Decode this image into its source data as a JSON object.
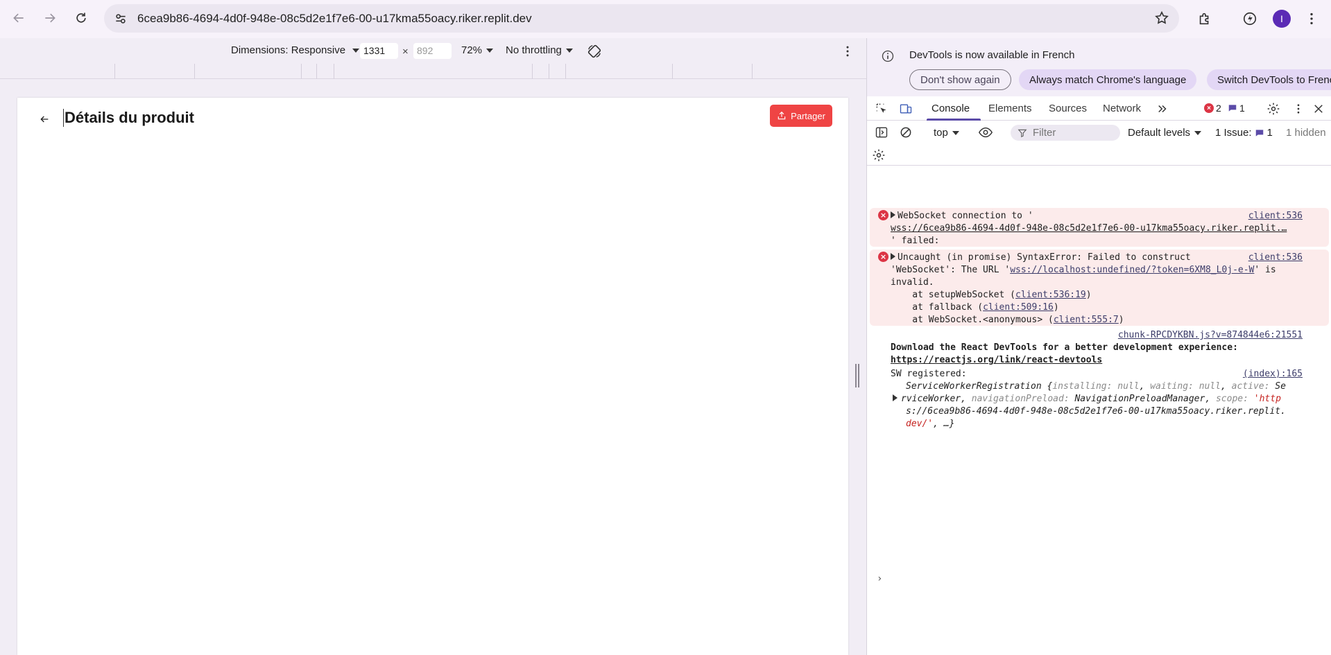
{
  "browser": {
    "url": "6cea9b86-4694-4d0f-948e-08c5d2e1f7e6-00-u17kma55oacy.riker.replit.dev",
    "avatar_letter": "I"
  },
  "device_toolbar": {
    "dimensions_label": "Dimensions: Responsive",
    "width_value": "1331",
    "height_value": "892",
    "times": "×",
    "zoom": "72%",
    "throttling": "No throttling"
  },
  "page": {
    "title": "Détails du produit",
    "share_label": "Partager"
  },
  "devtools": {
    "info": {
      "message": "DevTools is now available in French",
      "dont_show": "Don't show again",
      "always_match": "Always match Chrome's language",
      "switch": "Switch DevTools to French"
    },
    "tabs": [
      "Console",
      "Elements",
      "Sources",
      "Network"
    ],
    "error_count": "2",
    "message_count": "1",
    "console_bar": {
      "context": "top",
      "filter_placeholder": "Filter",
      "levels": "Default levels",
      "issues_label": "1 Issue:",
      "issues_count": "1",
      "hidden": "1 hidden"
    },
    "console": {
      "msg1": {
        "l1": "WebSocket connection to '",
        "l2": "wss://6cea9b86-4694-4d0f-948e-08c5d2e1f7e6-00-u17kma55oacy.riker.replit.…",
        "l3": "' failed:",
        "src": "client:536"
      },
      "msg2": {
        "l1": "Uncaught (in promise) SyntaxError: Failed to construct",
        "l2_pre": "'WebSocket': The URL '",
        "l2_link": "wss://localhost:undefined/?token=6XM8_L0j-e-W",
        "l2_post": "' is",
        "l3": "invalid.",
        "l4_pre": "    at setupWebSocket (",
        "l4_link": "client:536:19",
        "l5_pre": "    at fallback (",
        "l5_link": "client:509:16",
        "l6_pre": "    at WebSocket.<anonymous> (",
        "l6_link": "client:555:7",
        "close": ")",
        "src": "client:536"
      },
      "msg3": {
        "src": "chunk-RPCDYKBN.js?v=874844e6:21551",
        "l1": "Download the React DevTools for a better development experience:",
        "l2": "https://reactjs.org/link/react-devtools"
      },
      "msg4": {
        "l1": "SW registered:",
        "src": "(index):165",
        "obj_name": "ServiceWorkerRegistration {",
        "k_installing": "installing",
        "v_null": "null",
        "k_waiting": "waiting",
        "k_active": "active",
        "v_active_a": "Se",
        "v_active_b": "rviceWorker",
        "k_navpre": "navigationPreload",
        "v_navpre": "NavigationPreloadManager",
        "k_scope": "scope",
        "v_scope_a": "'http",
        "v_scope_b": "s://6cea9b86-4694-4d0f-948e-08c5d2e1f7e6-00-u17kma55oacy.riker.replit.",
        "v_scope_c": "dev/'",
        "tail": ", …}"
      },
      "prompt": "›"
    }
  }
}
